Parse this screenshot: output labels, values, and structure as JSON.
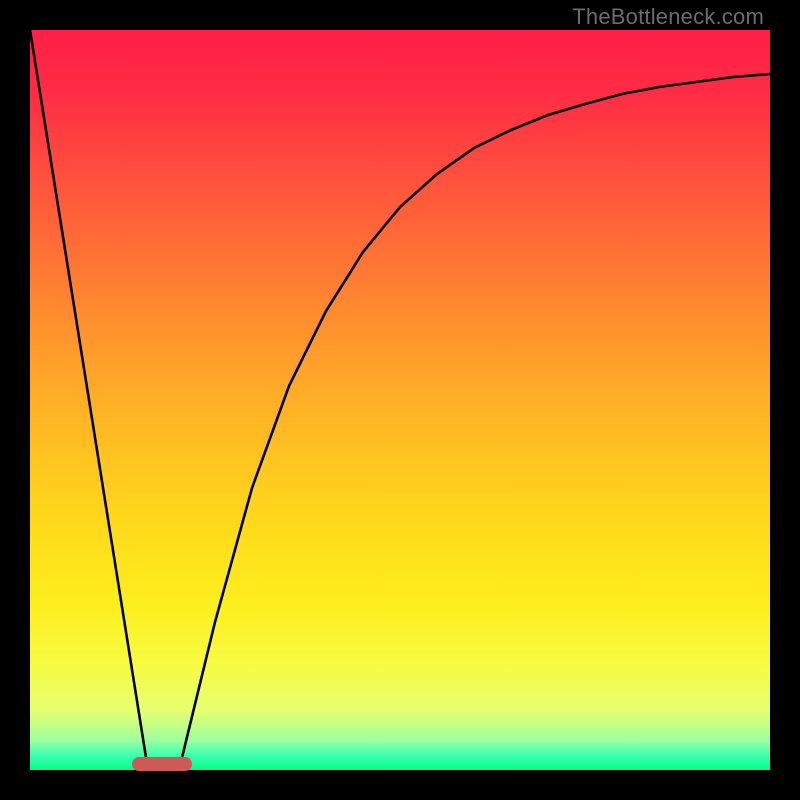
{
  "watermark": "TheBottleneck.com",
  "chart_data": {
    "type": "line",
    "title": "",
    "xlabel": "",
    "ylabel": "",
    "xlim": [
      0,
      100
    ],
    "ylim": [
      0,
      100
    ],
    "gradient_meaning": "top=red (bad), bottom=green (good)",
    "series": [
      {
        "name": "left-line",
        "x": [
          0,
          16
        ],
        "values": [
          100,
          0
        ]
      },
      {
        "name": "right-curve",
        "x": [
          20,
          25,
          30,
          35,
          40,
          45,
          50,
          55,
          60,
          65,
          70,
          75,
          80,
          85,
          90,
          95,
          100
        ],
        "values": [
          0,
          20,
          38,
          52,
          62,
          70,
          76,
          80.5,
          84,
          86.5,
          88.5,
          90,
          91.3,
          92.3,
          93,
          93.6,
          94
        ]
      }
    ],
    "marker": {
      "x_start": 14,
      "x_end": 22,
      "y": 0
    },
    "annotations": []
  },
  "colors": {
    "frame": "#000000",
    "curve": "#000000",
    "marker": "#cd5b55",
    "watermark": "#6c6c6c"
  }
}
